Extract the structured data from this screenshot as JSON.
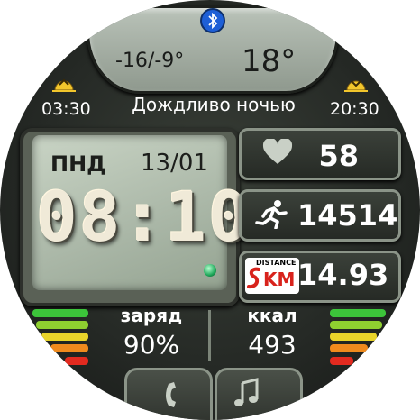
{
  "weather": {
    "temp_range": "-16/-9°",
    "temp_current": "18°",
    "sunrise": "03:30",
    "sunset": "20:30",
    "description": "Дождливо ночью"
  },
  "clock": {
    "day": "ПНД",
    "date": "13/01",
    "time": "08:10"
  },
  "stats": {
    "heart_rate": "58",
    "steps": "14514",
    "distance": "14.93",
    "distance_logo_top": "DISTANCE",
    "distance_logo_bottom": "KM"
  },
  "battery": {
    "label": "заряд",
    "value": "90%"
  },
  "calories": {
    "label": "ккал",
    "value": "493"
  },
  "icons": {
    "bluetooth": "bluetooth-icon",
    "sunrise": "sunrise-icon",
    "sunset": "sunset-icon",
    "heart": "heart-icon",
    "runner": "runner-icon",
    "distance": "distance-icon",
    "phone": "phone-icon",
    "music": "music-icon"
  },
  "colors": {
    "bluetooth": "#1e5fd6",
    "sun": "#f2c62c",
    "bar_green": "#3cc43a",
    "bar_yellow": "#e9d42a",
    "bar_orange": "#ef8a1d",
    "bar_red": "#e22a1f",
    "distance_logo": "#d8231c"
  }
}
